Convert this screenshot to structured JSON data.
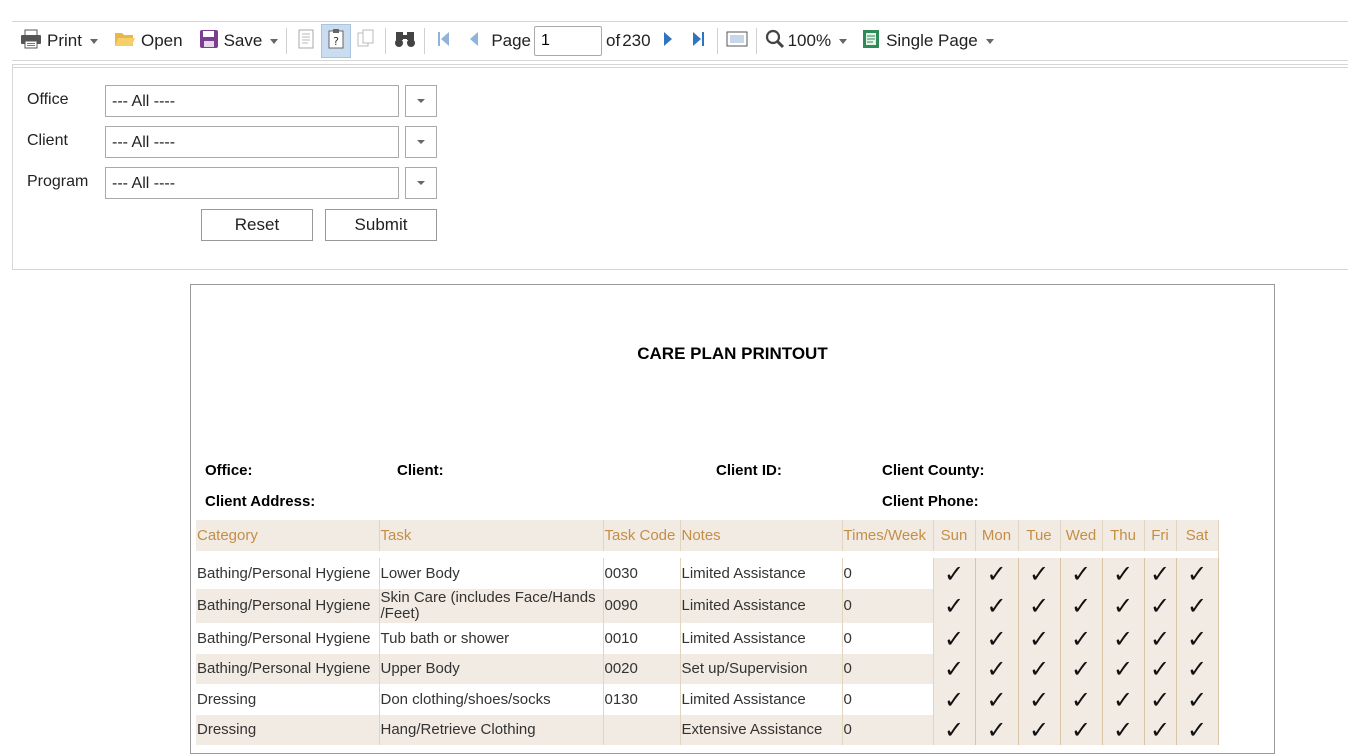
{
  "toolbar": {
    "print_label": "Print",
    "open_label": "Open",
    "save_label": "Save",
    "page_label": "Page",
    "page_value": "1",
    "of_label": "of",
    "total_pages": "230",
    "zoom_label": "100%",
    "view_mode_label": "Single Page"
  },
  "params": {
    "office_label": "Office",
    "office_value": "--- All ----",
    "client_label": "Client",
    "client_value": "--- All ----",
    "program_label": "Program",
    "program_value": "--- All ----",
    "reset_label": "Reset",
    "submit_label": "Submit"
  },
  "report": {
    "title": "CARE PLAN PRINTOUT",
    "office_label": "Office:",
    "client_label": "Client:",
    "client_id_label": "Client ID:",
    "client_county_label": "Client County:",
    "client_address_label": "Client Address:",
    "client_phone_label": "Client Phone:",
    "columns": [
      "Category",
      "Task",
      "Task Code",
      "Notes",
      "Times/Week",
      "Sun",
      "Mon",
      "Tue",
      "Wed",
      "Thu",
      "Fri",
      "Sat"
    ],
    "check_glyph": "✓",
    "rows": [
      {
        "category": "Bathing/Personal Hygiene",
        "task": "Lower Body",
        "code": "0030",
        "notes": "Limited Assistance",
        "times": "0"
      },
      {
        "category": "Bathing/Personal Hygiene",
        "task": "Skin Care (includes Face/Hands /Feet)",
        "code": "0090",
        "notes": "Limited Assistance",
        "times": "0"
      },
      {
        "category": "Bathing/Personal Hygiene",
        "task": "Tub bath or shower",
        "code": "0010",
        "notes": "Limited Assistance",
        "times": "0"
      },
      {
        "category": "Bathing/Personal Hygiene",
        "task": "Upper Body",
        "code": "0020",
        "notes": "Set up/Supervision",
        "times": "0"
      },
      {
        "category": "Dressing",
        "task": "Don clothing/shoes/socks",
        "code": "0130",
        "notes": "Limited Assistance",
        "times": "0"
      },
      {
        "category": "Dressing",
        "task": "Hang/Retrieve Clothing",
        "code": "",
        "notes": "Extensive Assistance",
        "times": "0"
      }
    ]
  }
}
